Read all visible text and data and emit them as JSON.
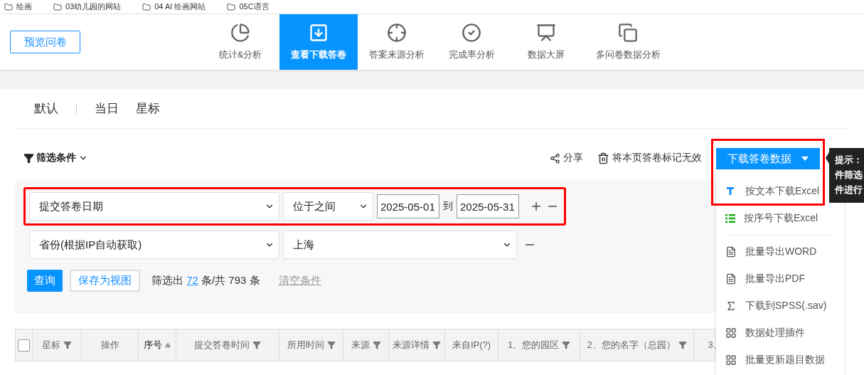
{
  "bookmarks": [
    {
      "label": "绘画"
    },
    {
      "label": "03幼儿园的网站"
    },
    {
      "label": "04 AI 绘画网站"
    },
    {
      "label": "05C语言"
    }
  ],
  "preview_button": "预览问卷",
  "nav": [
    {
      "label": "统计&分析",
      "kind": "pie",
      "selected": false
    },
    {
      "label": "查看下载答卷",
      "kind": "download",
      "selected": true
    },
    {
      "label": "答案来源分析",
      "kind": "crosshair",
      "selected": false
    },
    {
      "label": "完成率分析",
      "kind": "check",
      "selected": false
    },
    {
      "label": "数据大屏",
      "kind": "monitor",
      "selected": false
    },
    {
      "label": "多问卷数据分析",
      "kind": "copy",
      "selected": false
    }
  ],
  "tabs": [
    {
      "label": "默认"
    },
    {
      "label": "当日"
    },
    {
      "label": "星标"
    }
  ],
  "toolbar": {
    "filter_label": "筛选条件",
    "share": "分享",
    "invalidate": "将本页答卷标记无效"
  },
  "filters": {
    "rows": [
      {
        "kind": "date_range",
        "highlighted": true,
        "field": "提交答卷日期",
        "operator": "位于之间",
        "from": "2025-05-01",
        "sep": "到",
        "to": "2025-05-31"
      },
      {
        "kind": "select",
        "highlighted": false,
        "field": "省份(根据IP自动获取)",
        "value": "上海"
      }
    ],
    "query_button": "查询",
    "save_button": "保存为视图",
    "summary_prefix": "筛选出",
    "count": "72",
    "summary_suffix": "条/共 793 条",
    "clear": "清空条件"
  },
  "download": {
    "label": "下载答卷数据",
    "highlighted": true,
    "groups": [
      [
        {
          "label": "按文本下载Excel",
          "kind": "text"
        },
        {
          "label": "按序号下载Excel",
          "kind": "list"
        }
      ],
      [
        {
          "label": "批量导出WORD",
          "kind": "word"
        },
        {
          "label": "批量导出PDF",
          "kind": "pdf"
        },
        {
          "label": "下载到SPSS(.sav)",
          "kind": "spss"
        },
        {
          "label": "数据处理插件",
          "kind": "plugin"
        },
        {
          "label": "批量更新题目数据",
          "kind": "plugin"
        }
      ]
    ]
  },
  "tooltip": {
    "lines": [
      "提示：",
      "件筛选",
      "件进行"
    ]
  },
  "table": {
    "select_all": {
      "checked": false
    },
    "columns": [
      {
        "label": "星标",
        "kind": "filter"
      },
      {
        "label": "操作",
        "kind": "plain"
      },
      {
        "label": "序号",
        "kind": "sort"
      },
      {
        "label": "提交答卷时间",
        "kind": "filter"
      },
      {
        "label": "所用时间",
        "kind": "filter"
      },
      {
        "label": "来源",
        "kind": "filter"
      },
      {
        "label": "来源详情",
        "kind": "filter"
      },
      {
        "label": "来自IP(?)",
        "kind": "plain"
      },
      {
        "label": "1、您的园区",
        "kind": "filter"
      },
      {
        "label": "2、您的名字（总园）",
        "kind": "filter"
      },
      {
        "label": "3、",
        "kind": "plain"
      }
    ]
  }
}
